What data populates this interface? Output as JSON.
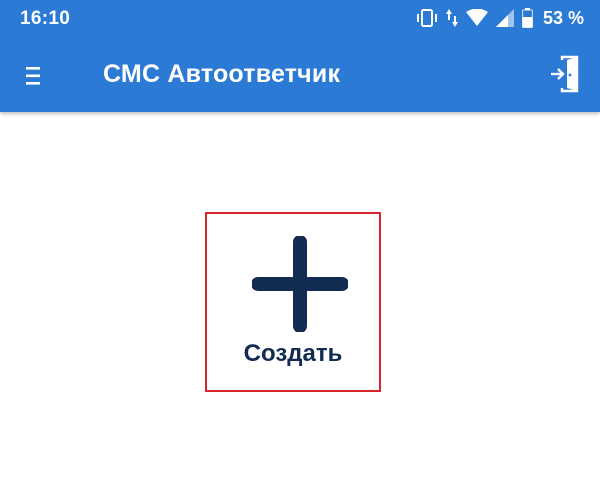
{
  "status_bar": {
    "time": "16:10",
    "battery_percent": "53 %",
    "icons": [
      "vibrate-icon",
      "data-arrows-icon",
      "wifi-icon",
      "signal-icon",
      "battery-icon"
    ]
  },
  "app_bar": {
    "title": "СМС Автоответчик",
    "background_color": "#2a7ad6",
    "menu_icon": "hamburger-menu-icon",
    "exit_icon": "exit-door-icon"
  },
  "main": {
    "create_button": {
      "label": "Создать",
      "icon": "plus-icon",
      "color": "#112b52",
      "highlight_color": "#d8262c"
    }
  }
}
